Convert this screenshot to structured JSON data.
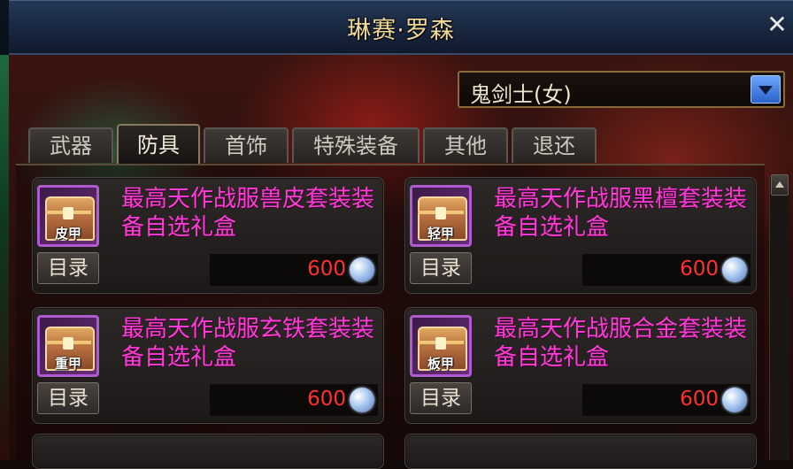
{
  "window": {
    "title": "琳赛·罗森"
  },
  "class_select": {
    "value": "鬼剑士(女)"
  },
  "tabs": [
    {
      "label": "武器",
      "active": false
    },
    {
      "label": "防具",
      "active": true
    },
    {
      "label": "首饰",
      "active": false
    },
    {
      "label": "特殊装备",
      "active": false
    },
    {
      "label": "其他",
      "active": false
    },
    {
      "label": "退还",
      "active": false
    }
  ],
  "items": [
    {
      "icon": "chest-box-icon",
      "icon_label": "皮甲",
      "name": "最高天作战服兽皮套装装备自选礼盒",
      "catalog": "目录",
      "price": "600"
    },
    {
      "icon": "chest-box-icon",
      "icon_label": "轻甲",
      "name": "最高天作战服黑檀套装装备自选礼盒",
      "catalog": "目录",
      "price": "600"
    },
    {
      "icon": "chest-box-icon",
      "icon_label": "重甲",
      "name": "最高天作战服玄铁套装装备自选礼盒",
      "catalog": "目录",
      "price": "600"
    },
    {
      "icon": "chest-box-icon",
      "icon_label": "板甲",
      "name": "最高天作战服合金套装装备自选礼盒",
      "catalog": "目录",
      "price": "600"
    }
  ],
  "colors": {
    "item_name": "#ff3cd6",
    "price": "#ff3030",
    "title": "#f0d89a"
  }
}
